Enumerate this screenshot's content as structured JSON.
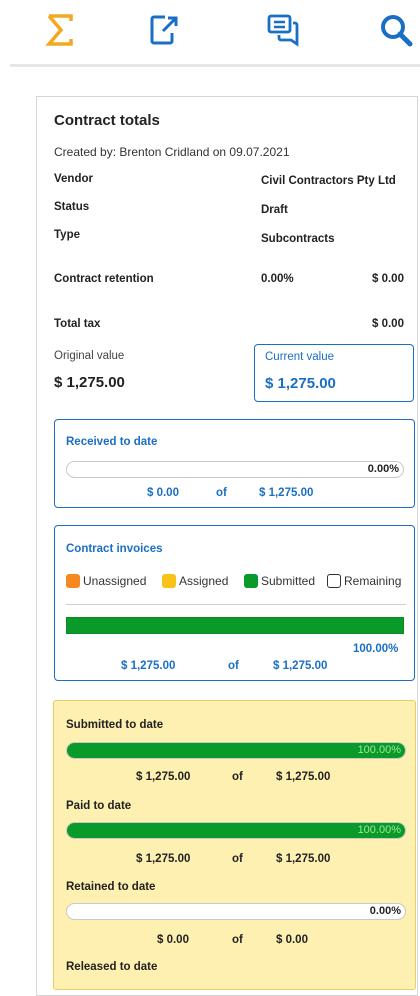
{
  "toolbar": {
    "icons": [
      "sigma-icon",
      "export-document-icon",
      "chat-icon",
      "search-icon"
    ],
    "colors": {
      "sigma": "#f2a91f",
      "others": "#1a6fc4"
    }
  },
  "contract": {
    "title": "Contract totals",
    "created_by": "Created by: Brenton Cridland on 09.07.2021",
    "vendor_label": "Vendor",
    "vendor_value": "Civil Contractors Pty Ltd",
    "status_label": "Status",
    "status_value": "Draft",
    "type_label": "Type",
    "type_value": "Subcontracts",
    "retention_label": "Contract retention",
    "retention_percent": "0.00%",
    "retention_amount": "$ 0.00",
    "total_tax_label": "Total tax",
    "total_tax_amount": "$ 0.00",
    "original_value_label": "Original value",
    "original_value": "$ 1,275.00",
    "current_value_label": "Current value",
    "current_value": "$ 1,275.00"
  },
  "received": {
    "label": "Received to date",
    "percent_text": "0.00%",
    "progress": 0,
    "amount": "$ 0.00",
    "of": "of",
    "total": "$ 1,275.00"
  },
  "invoices": {
    "label": "Contract invoices",
    "legend": [
      {
        "label": "Unassigned",
        "color": "#f5891f"
      },
      {
        "label": "Assigned",
        "color": "#f7c21a"
      },
      {
        "label": "Submitted",
        "color": "#0a9a2a"
      },
      {
        "label": "Remaining",
        "color": "#ffffff"
      }
    ],
    "progress": 1.0,
    "percent_text": "100.00%",
    "amount": "$ 1,275.00",
    "of": "of",
    "total": "$ 1,275.00"
  },
  "summary": {
    "submitted": {
      "label": "Submitted to date",
      "percent_text": "100.00%",
      "progress": 1.0,
      "amount": "$ 1,275.00",
      "of": "of",
      "total": "$ 1,275.00"
    },
    "paid": {
      "label": "Paid to date",
      "percent_text": "100.00%",
      "progress": 1.0,
      "amount": "$ 1,275.00",
      "of": "of",
      "total": "$ 1,275.00"
    },
    "retained": {
      "label": "Retained to date",
      "percent_text": "0.00%",
      "progress": 0,
      "amount": "$ 0.00",
      "of": "of",
      "total": "$ 0.00"
    },
    "released": {
      "label": "Released to date"
    }
  }
}
